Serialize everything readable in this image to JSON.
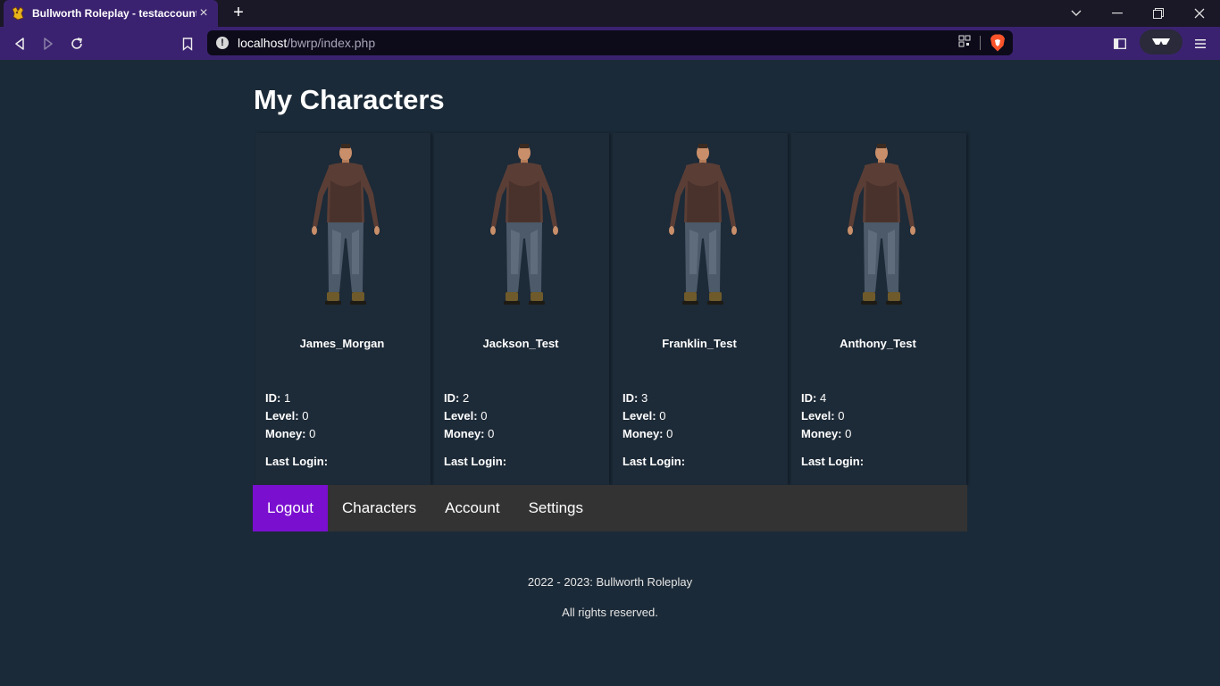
{
  "browser": {
    "tab_title": "Bullworth Roleplay - testaccount",
    "url_host": "localhost",
    "url_path": "/bwrp/index.php"
  },
  "page": {
    "title": "My Characters"
  },
  "labels": {
    "id": "ID:",
    "level": "Level:",
    "money": "Money:",
    "last_login": "Last Login:"
  },
  "characters": [
    {
      "name": "James_Morgan",
      "id": "1",
      "level": "0",
      "money": "0",
      "last_login": ""
    },
    {
      "name": "Jackson_Test",
      "id": "2",
      "level": "0",
      "money": "0",
      "last_login": ""
    },
    {
      "name": "Franklin_Test",
      "id": "3",
      "level": "0",
      "money": "0",
      "last_login": ""
    },
    {
      "name": "Anthony_Test",
      "id": "4",
      "level": "0",
      "money": "0",
      "last_login": ""
    }
  ],
  "nav": {
    "items": [
      {
        "label": "Logout",
        "active": true
      },
      {
        "label": "Characters"
      },
      {
        "label": "Account"
      },
      {
        "label": "Settings"
      }
    ]
  },
  "footer": {
    "line1": "2022 - 2023: Bullworth Roleplay",
    "line2": "All rights reserved."
  },
  "colors": {
    "page_bg": "#1b2a38",
    "card_bg": "#1d2a37",
    "nav_bg": "#333333",
    "nav_active": "#7a0fd0",
    "chrome_purple": "#3b2270"
  }
}
